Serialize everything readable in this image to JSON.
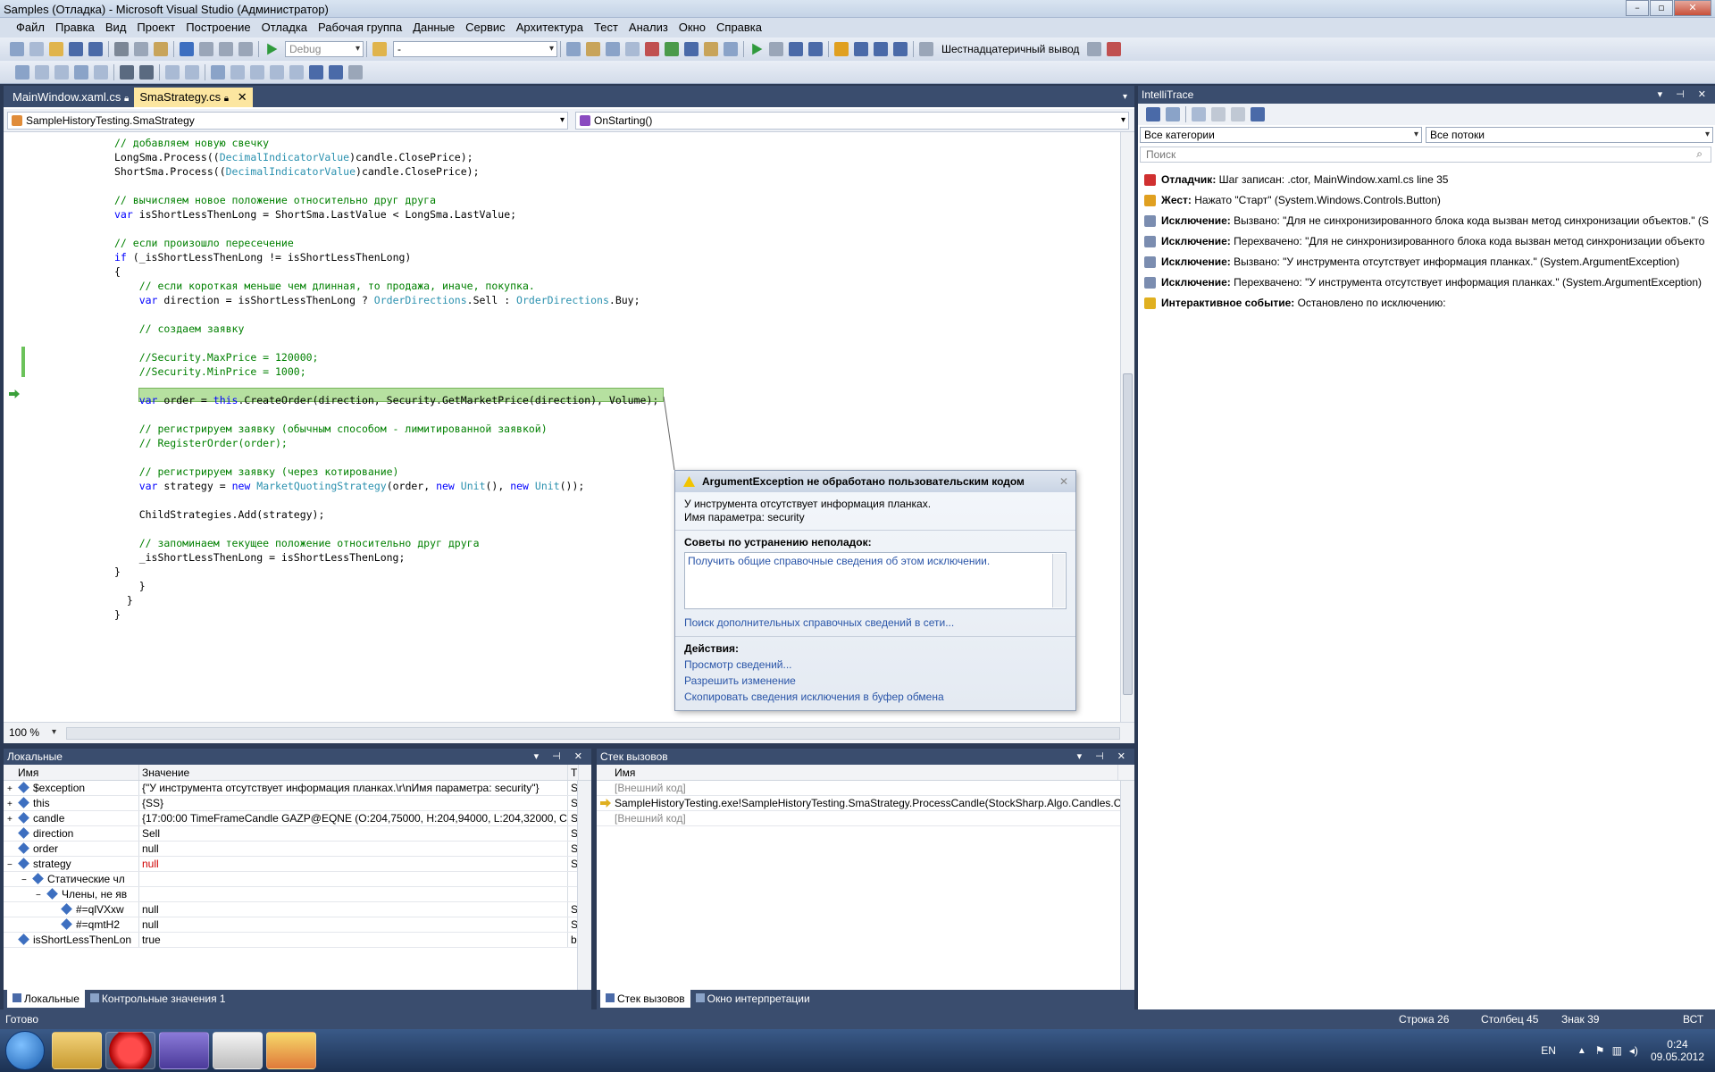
{
  "window": {
    "title": "Samples (Отладка) - Microsoft Visual Studio (Администратор)"
  },
  "menu": [
    "Файл",
    "Правка",
    "Вид",
    "Проект",
    "Построение",
    "Отладка",
    "Рабочая группа",
    "Данные",
    "Сервис",
    "Архитектура",
    "Тест",
    "Анализ",
    "Окно",
    "Справка"
  ],
  "toolbar": {
    "config": "Debug",
    "platform": "-",
    "hex_label": "Шестнадцатеричный вывод"
  },
  "tabs": [
    {
      "label": "MainWindow.xaml.cs"
    },
    {
      "label": "SmaStrategy.cs"
    }
  ],
  "nav": {
    "class": "SampleHistoryTesting.SmaStrategy",
    "member": "OnStarting()"
  },
  "code": [
    [
      [
        "c",
        "// добавляем новую свечку"
      ]
    ],
    [
      [
        "",
        "LongSma.Process(("
      ],
      [
        "ty",
        "DecimalIndicatorValue"
      ],
      [
        "",
        ")candle.ClosePrice);"
      ]
    ],
    [
      [
        "",
        "ShortSma.Process(("
      ],
      [
        "ty",
        "DecimalIndicatorValue"
      ],
      [
        "",
        ")candle.ClosePrice);"
      ]
    ],
    [],
    [
      [
        "c",
        "// вычисляем новое положение относительно друг друга"
      ]
    ],
    [
      [
        "k",
        "var"
      ],
      [
        "",
        " isShortLessThenLong = ShortSma.LastValue < LongSma.LastValue;"
      ]
    ],
    [],
    [
      [
        "c",
        "// если произошло пересечение"
      ]
    ],
    [
      [
        "k",
        "if"
      ],
      [
        "",
        " (_isShortLessThenLong != isShortLessThenLong)"
      ]
    ],
    [
      [
        "",
        "{"
      ]
    ],
    [
      [
        "c",
        "    // если короткая меньше чем длинная, то продажа, иначе, покупка."
      ]
    ],
    [
      [
        "k",
        "    var"
      ],
      [
        "",
        " direction = isShortLessThenLong ? "
      ],
      [
        "ty",
        "OrderDirections"
      ],
      [
        "",
        ".Sell : "
      ],
      [
        "ty",
        "OrderDirections"
      ],
      [
        "",
        ".Buy;"
      ]
    ],
    [],
    [
      [
        "c",
        "    // создаем заявку"
      ]
    ],
    [],
    [
      [
        "c",
        "    //Security.MaxPrice = 120000;"
      ]
    ],
    [
      [
        "c",
        "    //Security.MinPrice = 1000;"
      ]
    ],
    [],
    [
      [
        "k",
        "    var"
      ],
      [
        "",
        " order = "
      ],
      [
        "k",
        "this"
      ],
      [
        "",
        ".CreateOrder(direction, Security.GetMarketPrice(direction), Volume);"
      ]
    ],
    [],
    [
      [
        "c",
        "    // регистрируем заявку (обычным способом - лимитированной заявкой)"
      ]
    ],
    [
      [
        "c",
        "    // RegisterOrder(order);"
      ]
    ],
    [],
    [
      [
        "c",
        "    // регистрируем заявку (через котирование)"
      ]
    ],
    [
      [
        "k",
        "    var"
      ],
      [
        "",
        " strategy = "
      ],
      [
        "k",
        "new"
      ],
      [
        "",
        " "
      ],
      [
        "ty",
        "MarketQuotingStrategy"
      ],
      [
        "",
        "(order, "
      ],
      [
        "k",
        "new"
      ],
      [
        "",
        " "
      ],
      [
        "ty",
        "Unit"
      ],
      [
        "",
        "(), "
      ],
      [
        "k",
        "new"
      ],
      [
        "",
        " "
      ],
      [
        "ty",
        "Unit"
      ],
      [
        "",
        "());"
      ]
    ],
    [],
    [
      [
        "",
        "    ChildStrategies.Add(strategy);"
      ]
    ],
    [],
    [
      [
        "c",
        "    // запоминаем текущее положение относительно друг друга"
      ]
    ],
    [
      [
        "",
        "    _isShortLessThenLong = isShortLessThenLong;"
      ]
    ],
    [
      [
        "",
        "}"
      ]
    ],
    [
      [
        "",
        "    }"
      ]
    ],
    [
      [
        "",
        "  }"
      ]
    ],
    [
      [
        "",
        "}"
      ]
    ]
  ],
  "zoom": "100 %",
  "exception": {
    "title": "ArgumentException не обработано пользовательским кодом",
    "message": "У инструмента отсутствует информация планках.",
    "param": "Имя параметра: security",
    "tips_label": "Советы по устранению неполадок:",
    "tip_link": "Получить общие справочные сведения об этом исключении.",
    "search_link": "Поиск дополнительных справочных сведений в сети...",
    "actions_label": "Действия:",
    "actions": [
      "Просмотр сведений...",
      "Разрешить изменение",
      "Скопировать сведения исключения в буфер обмена"
    ]
  },
  "locals": {
    "title": "Локальные",
    "cols": [
      "Имя",
      "Значение",
      "Т"
    ],
    "rows": [
      {
        "name": "$exception",
        "value": "{\"У инструмента отсутствует информация планках.\\r\\nИмя параметра: security\"}",
        "type": "S",
        "exp": "+"
      },
      {
        "name": "this",
        "value": "{SS}",
        "type": "S",
        "exp": "+"
      },
      {
        "name": "candle",
        "value": "{17:00:00 TimeFrameCandle GAZP@EQNE (O:204,75000, H:204,94000, L:204,32000, C:204,50",
        "type": "S",
        "exp": "+"
      },
      {
        "name": "direction",
        "value": "Sell",
        "type": "S",
        "exp": ""
      },
      {
        "name": "order",
        "value": "null",
        "type": "S",
        "exp": ""
      },
      {
        "name": "strategy",
        "value": "null",
        "type": "S",
        "exp": "−"
      },
      {
        "name": "Статические чл",
        "value": "",
        "type": "",
        "exp": "−"
      },
      {
        "name": "Члены, не яв",
        "value": "",
        "type": "",
        "exp": "−"
      },
      {
        "name": "#=qlVXxw",
        "value": "null",
        "type": "S",
        "exp": ""
      },
      {
        "name": "#=qmtH2",
        "value": "null",
        "type": "S",
        "exp": ""
      },
      {
        "name": "isShortLessThenLon",
        "value": "true",
        "type": "b",
        "exp": ""
      }
    ],
    "tabs": [
      "Локальные",
      "Контрольные значения 1"
    ]
  },
  "callstack": {
    "title": "Стек вызовов",
    "col": "Имя",
    "rows": [
      "[Внешний код]",
      "SampleHistoryTesting.exe!SampleHistoryTesting.SmaStrategy.ProcessCandle(StockSharp.Algo.Candles.Ca",
      "[Внешний код]"
    ],
    "tabs": [
      "Стек вызовов",
      "Окно интерпретации"
    ]
  },
  "intellitrace": {
    "title": "IntelliTrace",
    "categories": "Все категории",
    "threads": "Все потоки",
    "search_placeholder": "Поиск",
    "events": [
      {
        "kind": "Отладчик:",
        "text": " Шаг записан: .ctor, MainWindow.xaml.cs line 35",
        "color": "#d03030"
      },
      {
        "kind": "Жест:",
        "text": " Нажато \"Старт\" (System.Windows.Controls.Button)",
        "color": "#e0a020"
      },
      {
        "kind": "Исключение:",
        "text": " Вызвано: \"Для не синхронизированного блока кода вызван метод синхронизации объектов.\" (S",
        "color": "#7b8db0"
      },
      {
        "kind": "Исключение:",
        "text": " Перехвачено: \"Для не синхронизированного блока кода вызван метод синхронизации объекто",
        "color": "#7b8db0"
      },
      {
        "kind": "Исключение:",
        "text": " Вызвано: \"У инструмента отсутствует информация планках.\" (System.ArgumentException)",
        "color": "#7b8db0"
      },
      {
        "kind": "Исключение:",
        "text": " Перехвачено: \"У инструмента отсутствует информация планках.\" (System.ArgumentException)",
        "color": "#7b8db0"
      },
      {
        "kind": "Интерактивное событие:",
        "text": " Остановлено по исключению:",
        "color": "#e0b020"
      }
    ]
  },
  "status": {
    "ready": "Готово",
    "line": "Строка 26",
    "col": "Столбец 45",
    "char": "Знак 39",
    "mode": "ВСТ"
  },
  "tray": {
    "lang": "EN",
    "time": "0:24",
    "date": "09.05.2012"
  }
}
